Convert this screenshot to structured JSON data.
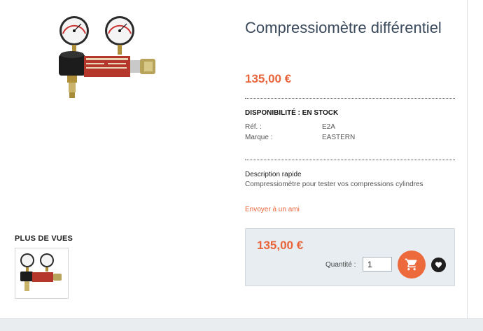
{
  "product": {
    "name": "Compressiomètre différentiel",
    "price": "135,00 €",
    "availability": "DISPONIBILITÉ : EN STOCK",
    "attributes": [
      {
        "key": "Réf. :",
        "value": "E2A"
      },
      {
        "key": "Marque :",
        "value": "EASTERN"
      }
    ],
    "short_description_title": "Description rapide",
    "short_description": "Compressiomètre pour tester vos compressions cylindres",
    "send_to_friend": "Envoyer à un ami"
  },
  "gallery": {
    "more_views_title": "PLUS DE VUES"
  },
  "buy_box": {
    "price": "135,00 €",
    "quantity_label": "Quantité :",
    "quantity_value": "1",
    "cart_icon": "cart-icon",
    "wishlist_icon": "heart-icon"
  },
  "colors": {
    "accent": "#e8643a",
    "title": "#3a4a5c",
    "box_bg": "#e8edf1"
  }
}
